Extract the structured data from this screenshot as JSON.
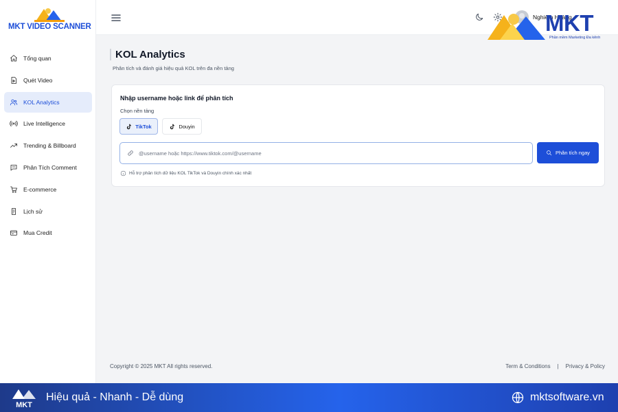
{
  "app": {
    "logo_text": "MKT VIDEO SCANNER"
  },
  "sidebar": {
    "items": [
      {
        "label": "Tổng quan"
      },
      {
        "label": "Quét Video"
      },
      {
        "label": "KOL Analytics"
      },
      {
        "label": "Live Intelligence"
      },
      {
        "label": "Trending & Billboard"
      },
      {
        "label": "Phân Tích Comment"
      },
      {
        "label": "E-commerce"
      },
      {
        "label": "Lịch sử"
      },
      {
        "label": "Mua Credit"
      }
    ],
    "active_index": 2
  },
  "topbar": {
    "user_name": "Nghiêm Hoàng"
  },
  "brand": {
    "name": "MKT",
    "tagline": "Phần mềm Marketing Đa kênh"
  },
  "page": {
    "title": "KOL Analytics",
    "subtitle": "Phân tích và đánh giá hiệu quả KOL trên đa nền tảng"
  },
  "form": {
    "title": "Nhập username hoặc link để phân tích",
    "platform_label": "Chọn nền tảng",
    "platforms": [
      {
        "label": "TikTok",
        "selected": true
      },
      {
        "label": "Douyin",
        "selected": false
      }
    ],
    "input_value": "",
    "input_placeholder": "@username hoặc https://www.tiktok.com/@username",
    "analyze_label": "Phân tích ngay",
    "hint": "Hỗ trợ phân tích dữ liệu KOL TikTok và Douyin chính xác nhất"
  },
  "footer": {
    "copyright": "Copyright © 2025 MKT All rights reserved.",
    "links": [
      "Term & Conditions",
      "Privacy & Policy"
    ],
    "separator": "|"
  },
  "banner": {
    "logo_text": "MKT",
    "slogan": "Hiệu quả - Nhanh - Dễ dùng",
    "website": "mktsoftware.vn"
  },
  "colors": {
    "accent": "#1d4ed8",
    "active_bg": "#e5ecfb",
    "logo_yellow": "#f5b21b",
    "banner_start": "#1e3a8a",
    "banner_end": "#2563eb"
  },
  "icons": {
    "nav": [
      "home-icon",
      "video-scan-icon",
      "users-icon",
      "broadcast-icon",
      "trending-icon",
      "comment-icon",
      "cart-icon",
      "history-icon",
      "credit-card-icon"
    ],
    "topbar": [
      "menu-icon",
      "moon-icon",
      "gear-icon",
      "logout-icon"
    ]
  }
}
